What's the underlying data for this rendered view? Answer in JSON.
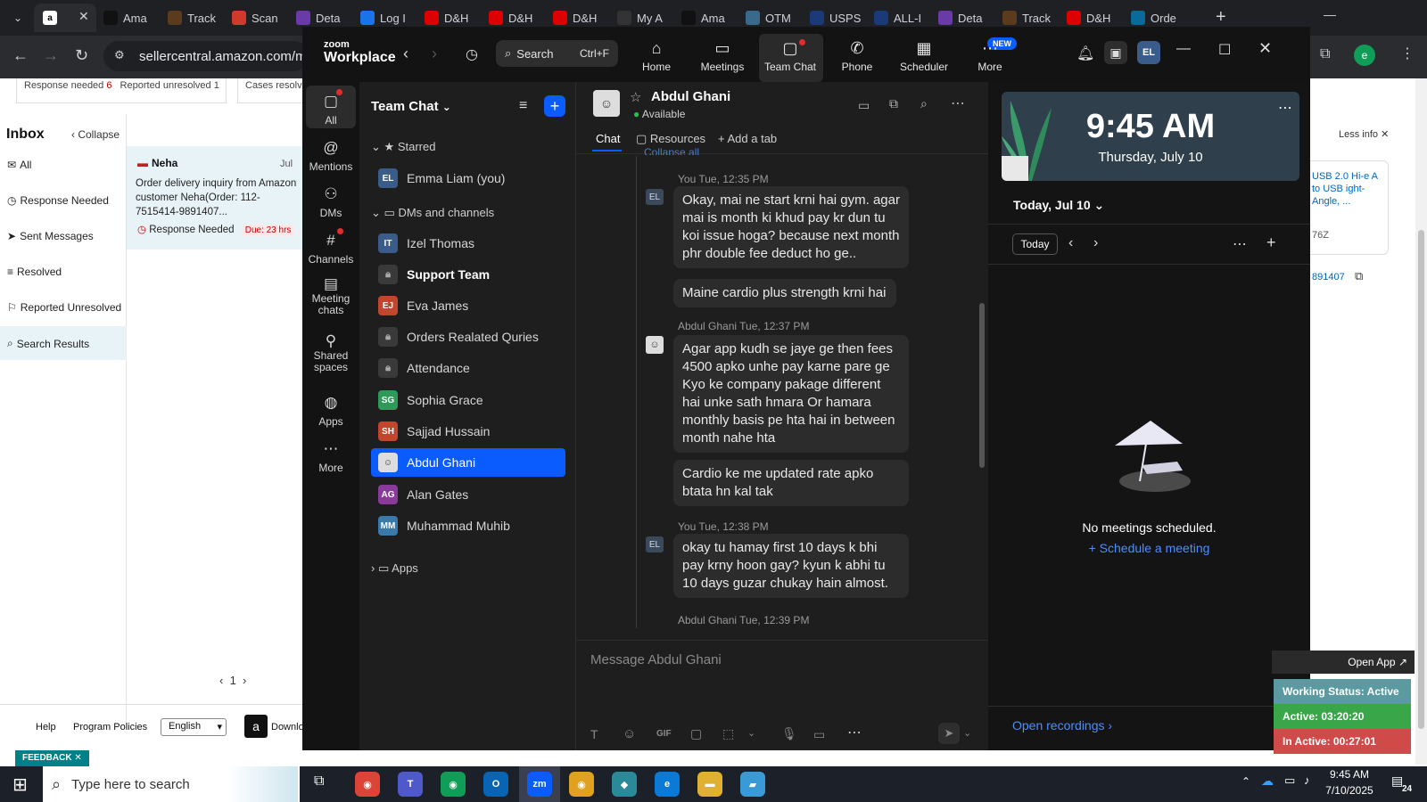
{
  "browser": {
    "tabs": [
      "Ama",
      "Track",
      "Scan",
      "Deta",
      "Log I",
      "D&H",
      "D&H",
      "D&H",
      "My A",
      "Ama",
      "OTM",
      "USPS",
      "ALL-I",
      "Deta",
      "Track",
      "D&H",
      "Orde"
    ],
    "url": "sellercentral.amazon.com/me"
  },
  "seller": {
    "filter_response": "Response needed",
    "filter_response_count": "6",
    "filter_unresolved": "Reported unresolved",
    "filter_unresolved_count": "1",
    "filter_cases": "Cases resolv",
    "inbox": "Inbox",
    "collapse": "Collapse",
    "nav": [
      "All",
      "Response Needed",
      "Sent Messages",
      "Resolved",
      "Reported Unresolved",
      "Search Results"
    ],
    "msg_name": "Neha",
    "msg_date": "Jul",
    "msg_text": "Order delivery inquiry from Amazon customer Neha(Order: 112-7515414-9891407...",
    "msg_status": "Response Needed",
    "msg_due": "Due: 23 hrs",
    "page": "1",
    "help": "Help",
    "policies": "Program Policies",
    "language": "English",
    "download": "Downlo",
    "feedback": "FEEDBACK"
  },
  "right_peek": {
    "less_info": "Less info",
    "product": "USB 2.0 Hi-e A to USB ight-Angle, ...",
    "code": "76Z",
    "order": "891407"
  },
  "zoom": {
    "logo_top": "zoom",
    "logo_bottom": "Workplace",
    "search": "Search",
    "shortcut": "Ctrl+F",
    "nav": [
      "Home",
      "Meetings",
      "Team Chat",
      "Phone",
      "Scheduler",
      "More"
    ],
    "new_badge": "NEW",
    "user_initials": "EL",
    "rail": [
      "All",
      "Mentions",
      "DMs",
      "Channels",
      "Meeting chats",
      "Shared spaces",
      "Apps",
      "More"
    ],
    "list_title": "Team Chat",
    "starred": "Starred",
    "dms_channels": "DMs and channels",
    "apps": "Apps",
    "contacts": [
      {
        "initials": "EL",
        "name": "Emma Liam (you)",
        "color": "#3a5c8a"
      },
      {
        "initials": "IT",
        "name": "Izel Thomas",
        "color": "#3a5c8a"
      },
      {
        "initials": "",
        "name": "Support Team",
        "color": "lock"
      },
      {
        "initials": "EJ",
        "name": "Eva James",
        "color": "#c2452d"
      },
      {
        "initials": "",
        "name": "Orders Realated Quries",
        "color": "lock"
      },
      {
        "initials": "",
        "name": "Attendance",
        "color": "lock"
      },
      {
        "initials": "SG",
        "name": "Sophia Grace",
        "color": "#2e9a5a"
      },
      {
        "initials": "SH",
        "name": "Sajjad Hussain",
        "color": "#c2452d"
      },
      {
        "initials": "",
        "name": "Abdul Ghani",
        "color": "photo"
      },
      {
        "initials": "AG",
        "name": "Alan Gates",
        "color": "#8a3a9a"
      },
      {
        "initials": "MM",
        "name": "Muhammad Muhib",
        "color": "#3a7aaa"
      }
    ],
    "chat_name": "Abdul Ghani",
    "chat_status": "Available",
    "chat_tabs": [
      "Chat",
      "Resources",
      "Add a tab"
    ],
    "collapse_all": "Collapse all",
    "messages": [
      {
        "sender": "You",
        "time": "Tue, 12:35 PM",
        "text": "Okay, mai ne start krni hai gym. agar mai is month ki khud pay kr dun tu koi issue hoga? because next month phr double fee deduct ho ge.."
      },
      {
        "sender": "",
        "time": "",
        "text": "Maine cardio plus strength krni hai"
      },
      {
        "sender": "Abdul Ghani",
        "time": "Tue, 12:37 PM",
        "text": "Agar app kudh se jaye ge then fees 4500 apko unhe pay karne pare ge Kyo ke company pakage different hai unke sath hmara Or hamara monthly basis pe hta hai in between month nahe hta"
      },
      {
        "sender": "",
        "time": "",
        "text": "Cardio ke me updated rate apko btata hn kal tak"
      },
      {
        "sender": "You",
        "time": "Tue, 12:38 PM",
        "text": "okay tu hamay first 10 days k bhi pay krny hoon gay? kyun k abhi tu 10 days guzar chukay hain almost."
      },
      {
        "sender": "Abdul Ghani",
        "time": "Tue, 12:39 PM",
        "text": ""
      }
    ],
    "composer_placeholder": "Message Abdul Ghani",
    "gif": "GIF",
    "clock_time": "9:45 AM",
    "clock_date": "Thursday, July 10",
    "today_label": "Today, Jul 10",
    "today_btn": "Today",
    "no_meetings": "No meetings scheduled.",
    "schedule": "Schedule a meeting",
    "open_recordings": "Open recordings"
  },
  "status_widget": {
    "open_app": "Open App",
    "working": "Working Status: Active",
    "active": "Active: 03:20:20",
    "inactive": "In Active: 00:27:01"
  },
  "taskbar": {
    "search": "Type here to search",
    "time": "9:45 AM",
    "date": "7/10/2025",
    "notif": "24"
  }
}
